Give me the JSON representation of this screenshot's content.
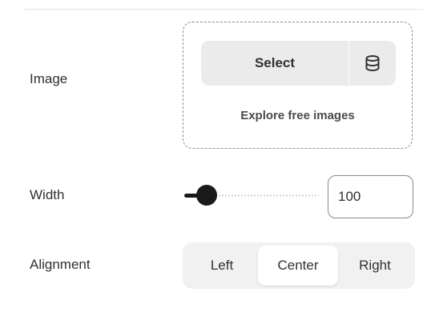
{
  "image_setting": {
    "label": "Image",
    "select_label": "Select",
    "library_icon": "database-icon",
    "explore_label": "Explore free images"
  },
  "width_setting": {
    "label": "Width",
    "value": "100",
    "slider_level": 0.15
  },
  "alignment_setting": {
    "label": "Alignment",
    "options": [
      "Left",
      "Center",
      "Right"
    ],
    "selected": "Center"
  }
}
